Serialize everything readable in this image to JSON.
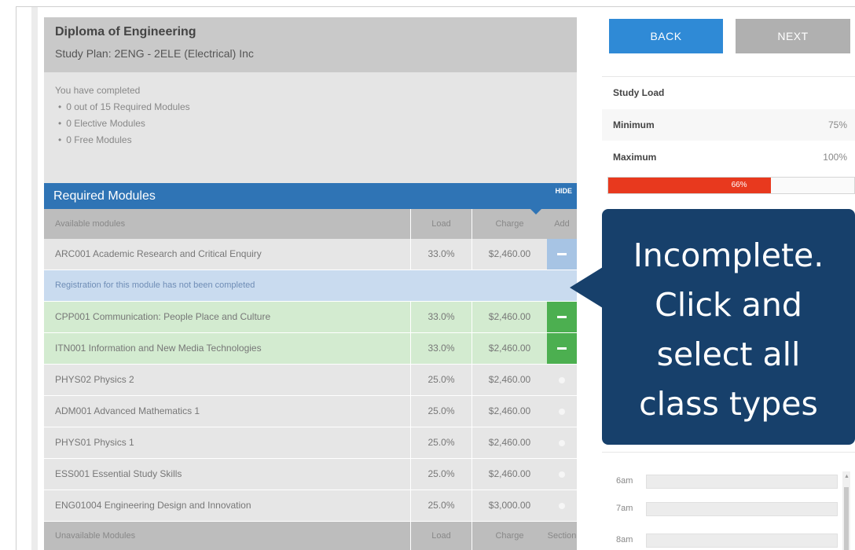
{
  "course": {
    "title": "Diploma of Engineering",
    "study_plan": "Study Plan: 2ENG - 2ELE (Electrical) Inc"
  },
  "progress": {
    "intro": "You have completed",
    "items": [
      "0 out of 15 Required Modules",
      "0 Elective Modules",
      "0 Free Modules"
    ]
  },
  "required": {
    "title": "Required Modules",
    "hide_label": "HIDE",
    "columns": {
      "name": "Available modules",
      "load": "Load",
      "charge": "Charge",
      "action": "Add"
    },
    "rows": [
      {
        "name": "ARC001 Academic Research and Critical Enquiry",
        "load": "33.0%",
        "charge": "$2,460.00",
        "state": "selected"
      },
      {
        "notice": "Registration for this module has not been completed"
      },
      {
        "name": "CPP001 Communication: People Place and Culture",
        "load": "33.0%",
        "charge": "$2,460.00",
        "state": "added"
      },
      {
        "name": "ITN001 Information and New Media Technologies",
        "load": "33.0%",
        "charge": "$2,460.00",
        "state": "added"
      },
      {
        "name": "PHYS02 Physics 2",
        "load": "25.0%",
        "charge": "$2,460.00",
        "state": "none"
      },
      {
        "name": "ADM001 Advanced Mathematics 1",
        "load": "25.0%",
        "charge": "$2,460.00",
        "state": "none"
      },
      {
        "name": "PHYS01 Physics 1",
        "load": "25.0%",
        "charge": "$2,460.00",
        "state": "none"
      },
      {
        "name": "ESS001 Essential Study Skills",
        "load": "25.0%",
        "charge": "$2,460.00",
        "state": "none"
      },
      {
        "name": "ENG01004 Engineering Design and Innovation",
        "load": "25.0%",
        "charge": "$3,000.00",
        "state": "none"
      }
    ],
    "unavailable": {
      "name": "Unavailable Modules",
      "load": "Load",
      "charge": "Charge",
      "action": "Section"
    }
  },
  "nav": {
    "back_label": "BACK",
    "next_label": "NEXT"
  },
  "study_load": {
    "title": "Study Load",
    "minimum_label": "Minimum",
    "minimum_value": "75%",
    "maximum_label": "Maximum",
    "maximum_value": "100%",
    "current_label": "66%",
    "current_fraction": 0.66
  },
  "callout": {
    "lines": [
      "Incomplete.",
      "Click and",
      "select all",
      "class types"
    ]
  },
  "timetable": {
    "times": [
      "6am",
      "7am",
      "8am"
    ]
  },
  "colors": {
    "accent_blue": "#2f74b5",
    "added_green": "#4caf50",
    "load_red": "#e8391e",
    "callout_navy": "#17406b"
  }
}
